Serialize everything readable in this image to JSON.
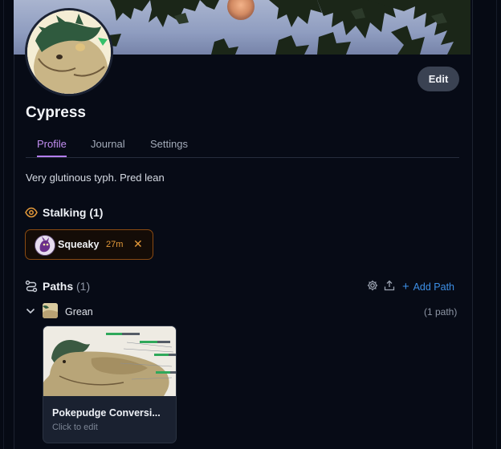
{
  "profile": {
    "name": "Cypress",
    "bio": "Very glutinous typh. Pred lean",
    "edit_label": "Edit"
  },
  "tabs": [
    {
      "label": "Profile",
      "active": true
    },
    {
      "label": "Journal",
      "active": false
    },
    {
      "label": "Settings",
      "active": false
    }
  ],
  "stalking": {
    "title": "Stalking",
    "count": "(1)",
    "items": [
      {
        "name": "Squeaky",
        "time": "27m",
        "remove": "✕"
      }
    ]
  },
  "paths": {
    "title": "Paths",
    "count": "(1)",
    "add_label": "Add Path",
    "groups": [
      {
        "name": "Grean",
        "count_label": "(1 path)",
        "cards": [
          {
            "title": "Pokepudge Conversi...",
            "subtitle": "Click to edit"
          }
        ]
      }
    ]
  },
  "colors": {
    "accent_purple": "#b47ef0",
    "stalk_orange": "#e59a3a",
    "link_blue": "#3d8fe6",
    "background": "#070b16"
  },
  "icons": {
    "stalking": "eye-icon",
    "paths": "route-icon",
    "settings": "gear-icon",
    "share": "upload-icon",
    "add": "plus-icon",
    "expand": "chevron-down-icon",
    "remove": "close-icon"
  }
}
